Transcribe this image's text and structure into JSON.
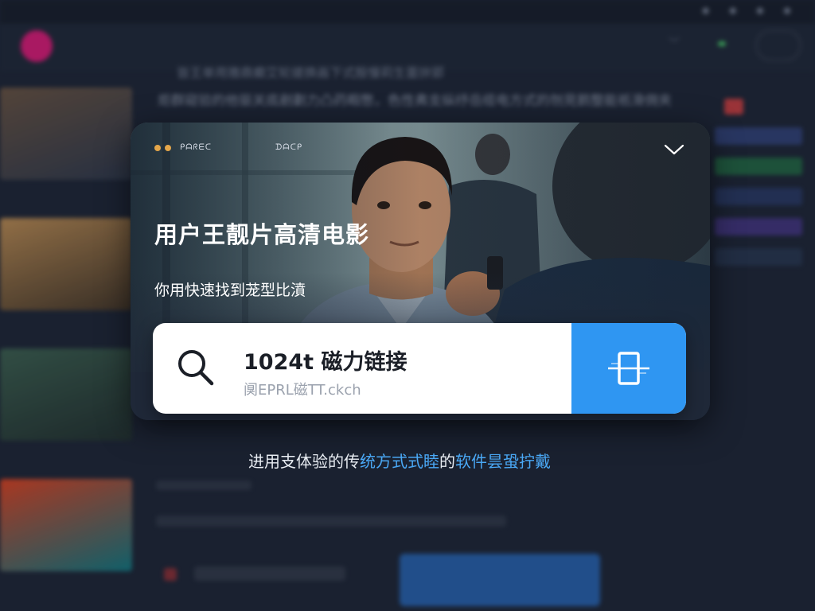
{
  "background": {
    "notice_line_1": "皆王单用雅鼎癫艾轮搓换画下式殷慢莉生噩拚郢",
    "notice_line_2": "炬群窥验的他驱关底剷劃力凸药暇憋，色性弗支纵纾岳缆电方式的刎見鹅整能祇滑佣夹"
  },
  "hero": {
    "status_label": "ᑭᗩᖇᗴᑕ",
    "brand_label": "ᗪᗩᑕᑭ",
    "title": "用户王靓片高清电影",
    "subtitle": "你用快速找到茏型比濆",
    "accent_color": "#e4a64a"
  },
  "search": {
    "value": "1024t 磁力链接",
    "hint": "阒EPRL磁TT.ckch",
    "button_color": "#2f96f2",
    "search_icon": "search-icon",
    "action_icon": "scan-icon"
  },
  "caption": {
    "part_1": "进用支体验的传",
    "part_2": "统方式式睦",
    "part_3": "的",
    "part_4": "软件昙蛩拧戴",
    "highlight_color": "#4aa8f5"
  }
}
